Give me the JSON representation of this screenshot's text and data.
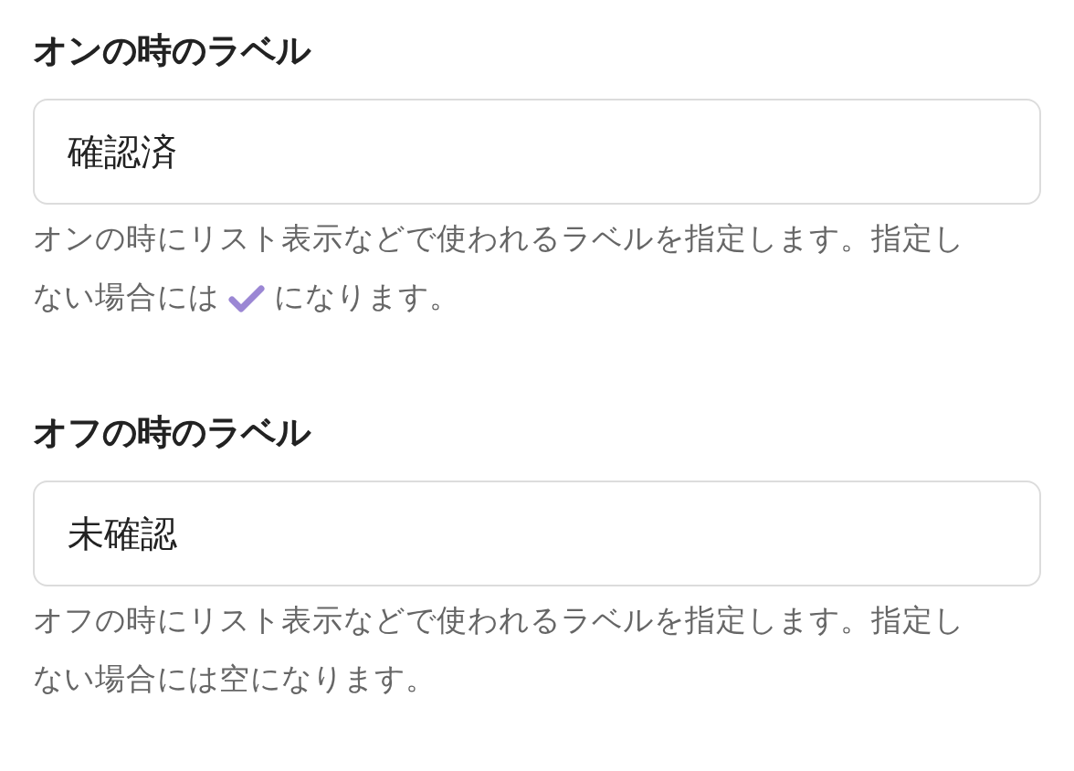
{
  "fields": [
    {
      "label": "オンの時のラベル",
      "value": "確認済",
      "help": [
        [
          {
            "kind": "text",
            "text": "オンの時にリスト表示などで使われるラベルを指定します。指定し"
          }
        ],
        [
          {
            "kind": "text",
            "text": "ない場合には"
          },
          {
            "kind": "check"
          },
          {
            "kind": "text",
            "text": "になります。"
          }
        ]
      ]
    },
    {
      "label": "オフの時のラベル",
      "value": "未確認",
      "help": [
        [
          {
            "kind": "text",
            "text": "オフの時にリスト表示などで使われるラベルを指定します。指定し"
          }
        ],
        [
          {
            "kind": "text",
            "text": "ない場合には空になります。"
          }
        ]
      ]
    }
  ]
}
